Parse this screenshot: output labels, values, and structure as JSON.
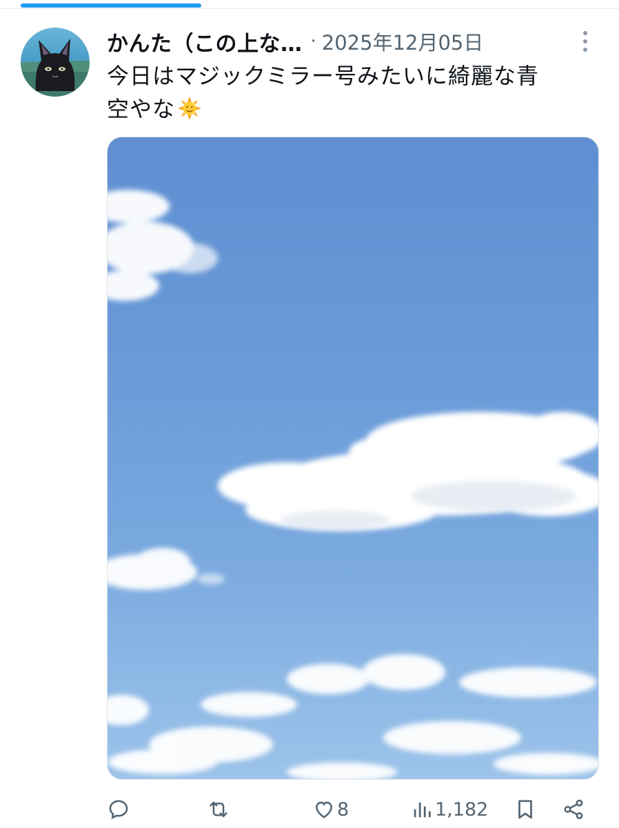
{
  "post": {
    "display_name": "かんた（この上な…",
    "separator": "·",
    "date": "2025年12月05日",
    "text_line1": "今日はマジックミラー号みたいに綺麗な青",
    "text_line2": "空やな"
  },
  "actions": {
    "reply": {
      "icon": "reply-icon",
      "count": ""
    },
    "repost": {
      "icon": "repost-icon",
      "count": ""
    },
    "like": {
      "icon": "heart-icon",
      "count": "8"
    },
    "views": {
      "icon": "analytics-icon",
      "count": "1,182"
    },
    "bookmark": {
      "icon": "bookmark-icon"
    },
    "share": {
      "icon": "share-icon"
    }
  },
  "colors": {
    "accent": "#1d9bf0",
    "text_primary": "#0f1419",
    "text_secondary": "#536471",
    "sky_blue": "#6a9ad8"
  }
}
